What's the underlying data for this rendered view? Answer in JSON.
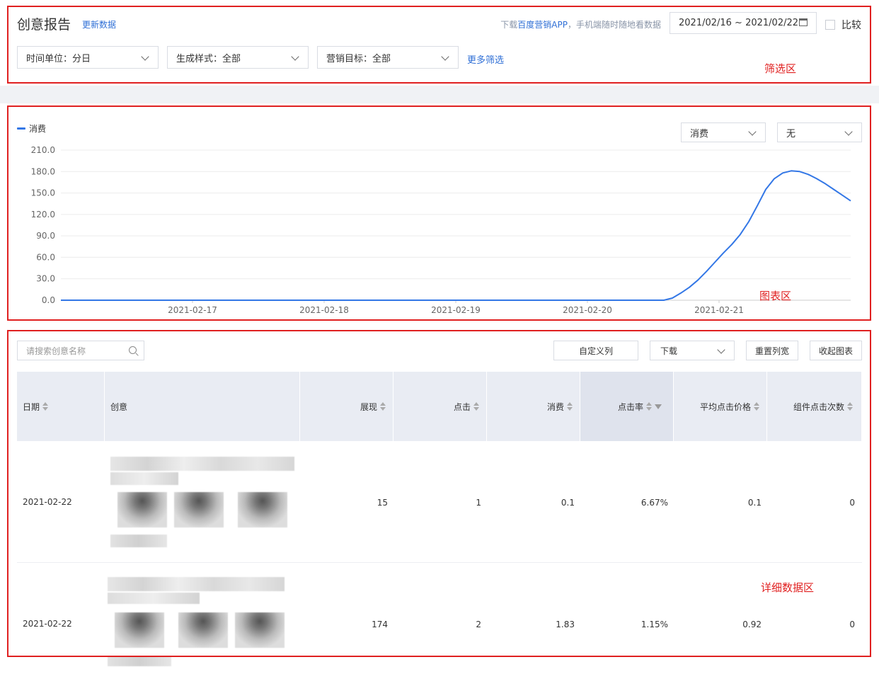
{
  "header": {
    "title": "创意报告",
    "update_link": "更新数据",
    "promo_prefix": "下载",
    "promo_link": "百度营销APP",
    "promo_suffix": "，手机端随时随地看数据",
    "date_range": "2021/02/16 ~ 2021/02/22",
    "compare_label": "比较"
  },
  "filters": {
    "time_unit": "时间单位：分日",
    "style": "生成样式：全部",
    "target": "营销目标：全部",
    "more": "更多筛选"
  },
  "annotations": {
    "filter_area": "筛选区",
    "chart_area": "图表区",
    "detail_area": "详细数据区"
  },
  "chart_controls": {
    "metric_select": "消费",
    "compare_select": "无"
  },
  "chart_data": {
    "type": "line",
    "series": [
      {
        "name": "消费",
        "color": "#3377e6",
        "values": [
          0,
          0,
          0,
          0,
          0,
          0,
          0,
          0,
          0,
          0,
          0,
          0,
          0,
          0,
          0,
          0,
          0,
          0,
          0,
          0,
          0,
          0,
          0,
          0,
          0,
          0,
          0,
          0,
          0,
          0,
          0,
          0,
          0,
          0,
          0,
          0,
          0,
          0,
          0,
          0,
          0,
          0,
          0,
          0,
          0,
          0,
          0,
          0,
          0,
          0,
          0,
          0,
          0,
          0,
          0,
          0,
          0,
          0,
          0,
          0,
          0,
          0,
          0,
          0,
          0,
          0,
          0,
          0,
          0,
          0,
          0,
          0,
          3,
          10,
          18,
          28,
          40,
          53,
          66,
          78,
          92,
          110,
          132,
          155,
          170,
          178,
          181,
          180,
          176,
          170,
          163,
          155,
          147,
          139
        ]
      }
    ],
    "x_start": "2021-02-16",
    "xticks": [
      "2021-02-17",
      "2021-02-18",
      "2021-02-19",
      "2021-02-20",
      "2021-02-21"
    ],
    "yticks": [
      "210.0",
      "180.0",
      "150.0",
      "120.0",
      "90.0",
      "60.0",
      "30.0",
      "0.0"
    ],
    "ylim": [
      0,
      210
    ]
  },
  "toolbar": {
    "search_placeholder": "请搜索创意名称",
    "custom_columns": "自定义列",
    "download": "下载",
    "reset_width": "重置列宽",
    "collapse_chart": "收起图表"
  },
  "table": {
    "columns": [
      "日期",
      "创意",
      "展现",
      "点击",
      "消费",
      "点击率",
      "平均点击价格",
      "组件点击次数"
    ],
    "rows": [
      {
        "date": "2021-02-22",
        "impressions": "15",
        "clicks": "1",
        "cost": "0.1",
        "ctr": "6.67%",
        "cpc": "0.1",
        "component_clicks": "0"
      },
      {
        "date": "2021-02-22",
        "impressions": "174",
        "clicks": "2",
        "cost": "1.83",
        "ctr": "1.15%",
        "cpc": "0.92",
        "component_clicks": "0"
      }
    ]
  }
}
